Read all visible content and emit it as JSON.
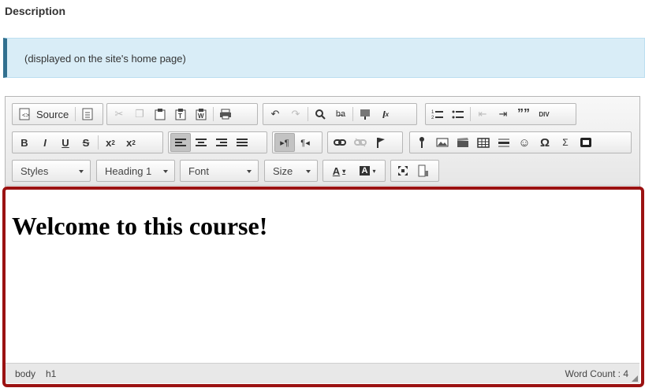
{
  "page": {
    "description_label": "Description",
    "info_text": "(displayed on the site's home page)"
  },
  "toolbar": {
    "source_label": "Source",
    "styles_value": "Styles",
    "format_value": "Heading 1",
    "font_value": "Font",
    "size_value": "Size",
    "text_color_glyph": "A",
    "bg_color_glyph": "A",
    "quote_glyph": "””",
    "div_glyph": "DIV",
    "omega_glyph": "Ω",
    "sigma_glyph": "Σ",
    "bold_glyph": "B",
    "italic_glyph": "I",
    "underline_glyph": "U",
    "strike_glyph": "S"
  },
  "editor": {
    "heading_text": "Welcome to this course!"
  },
  "statusbar": {
    "path": [
      "body",
      "h1"
    ],
    "word_count": "Word Count : 4"
  },
  "colors": {
    "highlight_border": "#9b1212",
    "info_background": "#d9edf7",
    "info_accent": "#31708f"
  }
}
